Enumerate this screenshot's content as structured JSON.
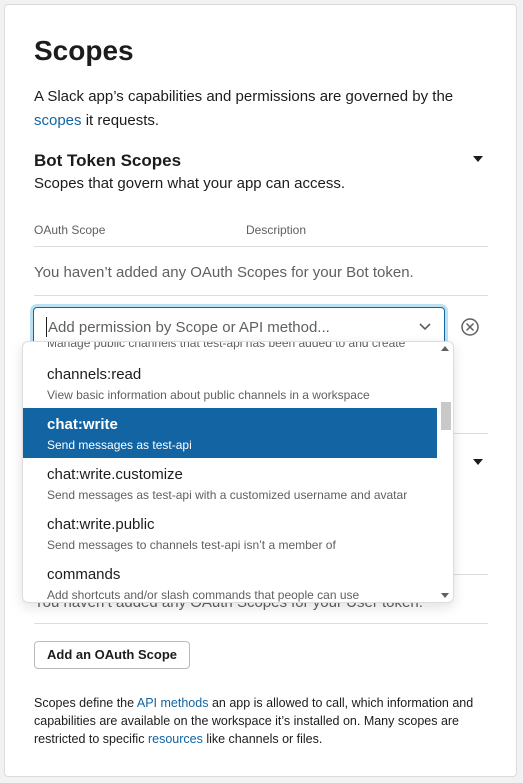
{
  "page": {
    "title": "Scopes",
    "intro_before": "A Slack app’s capabilities and permissions are governed by the",
    "intro_link": "scopes",
    "intro_after": "it requests."
  },
  "bot_section": {
    "title": "Bot Token Scopes",
    "subtitle": "Scopes that govern what your app can access.",
    "columns": [
      "OAuth Scope",
      "Description"
    ],
    "empty_text": "You haven’t added any OAuth Scopes for your Bot token."
  },
  "select": {
    "placeholder": "Add permission by Scope or API method..."
  },
  "dropdown": {
    "partial_text": "Manage public channels that test-api has been added to and create",
    "options": [
      {
        "name": "channels:read",
        "desc": "View basic information about public channels in a workspace"
      },
      {
        "name": "chat:write",
        "desc": "Send messages as test-api"
      },
      {
        "name": "chat:write.customize",
        "desc": "Send messages as test-api with a customized username and avatar"
      },
      {
        "name": "chat:write.public",
        "desc": "Send messages to channels test-api isn’t a member of"
      },
      {
        "name": "commands",
        "desc": "Add shortcuts and/or slash commands that people can use"
      }
    ],
    "selected_index": 1
  },
  "user_section": {
    "empty_text": "You haven’t added any OAuth Scopes for your User token."
  },
  "add_button": "Add an OAuth Scope",
  "footer": {
    "t1": "Scopes define the",
    "link1": "API methods",
    "t2": "an app is allowed to call, which information and capabilities are available on the workspace it’s installed on. Many scopes are restricted to specific",
    "link2": "resources",
    "t3": "like channels or files."
  },
  "colors": {
    "accent": "#1264a3",
    "text": "#1d1c1d",
    "muted": "#616061"
  },
  "icons": [
    "collapse-triangle-icon",
    "chevron-down-icon",
    "clear-circle-x-icon",
    "scroll-up-arrow-icon",
    "scroll-down-arrow-icon"
  ]
}
